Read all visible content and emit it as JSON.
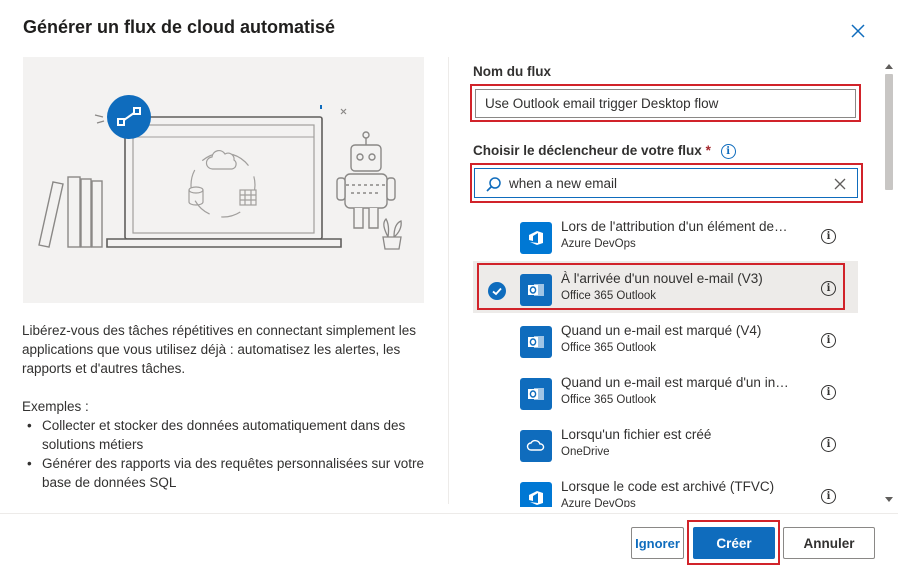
{
  "dialog": {
    "title": "Générer un flux de cloud automatisé",
    "close_icon": "close-icon"
  },
  "left": {
    "description": "Libérez-vous des tâches répétitives en connectant simplement les applications que vous utilisez déjà : automatisez les alertes, les rapports et d'autres tâches.",
    "examples_label": "Exemples :",
    "examples": [
      "Collecter et stocker des données automatiquement dans des solutions métiers",
      "Générer des rapports via des requêtes personnalisées sur votre base de données SQL"
    ]
  },
  "form": {
    "flow_name_label": "Nom du flux",
    "flow_name_value": "Use Outlook email trigger Desktop flow",
    "trigger_label": "Choisir le déclencheur de votre flux",
    "required_mark": "*",
    "search_value": "when a new email",
    "search_icon": "search-icon",
    "clear_icon": "clear-icon"
  },
  "triggers": [
    {
      "title": "Lors de l'attribution d'un élément de…",
      "connector": "Azure DevOps",
      "icon": "azure-devops-icon",
      "color": "#0078d4",
      "selected": false
    },
    {
      "title": "À l'arrivée d'un nouvel e-mail (V3)",
      "connector": "Office 365 Outlook",
      "icon": "outlook-icon",
      "color": "#0f6cbd",
      "selected": true
    },
    {
      "title": "Quand un e-mail est marqué (V4)",
      "connector": "Office 365 Outlook",
      "icon": "outlook-icon",
      "color": "#0f6cbd",
      "selected": false
    },
    {
      "title": "Quand un e-mail est marqué d'un in…",
      "connector": "Office 365 Outlook",
      "icon": "outlook-icon",
      "color": "#0f6cbd",
      "selected": false
    },
    {
      "title": "Lorsqu'un fichier est créé",
      "connector": "OneDrive",
      "icon": "onedrive-icon",
      "color": "#0f6cbd",
      "selected": false
    },
    {
      "title": "Lorsque le code est archivé (TFVC)",
      "connector": "Azure DevOps",
      "icon": "azure-devops-icon",
      "color": "#0078d4",
      "selected": false
    }
  ],
  "footer": {
    "ignore_label": "Ignorer",
    "create_label": "Créer",
    "cancel_label": "Annuler"
  },
  "colors": {
    "accent": "#0f6cbd",
    "highlight_box": "#d1232a",
    "selected_row": "#edebe9"
  }
}
